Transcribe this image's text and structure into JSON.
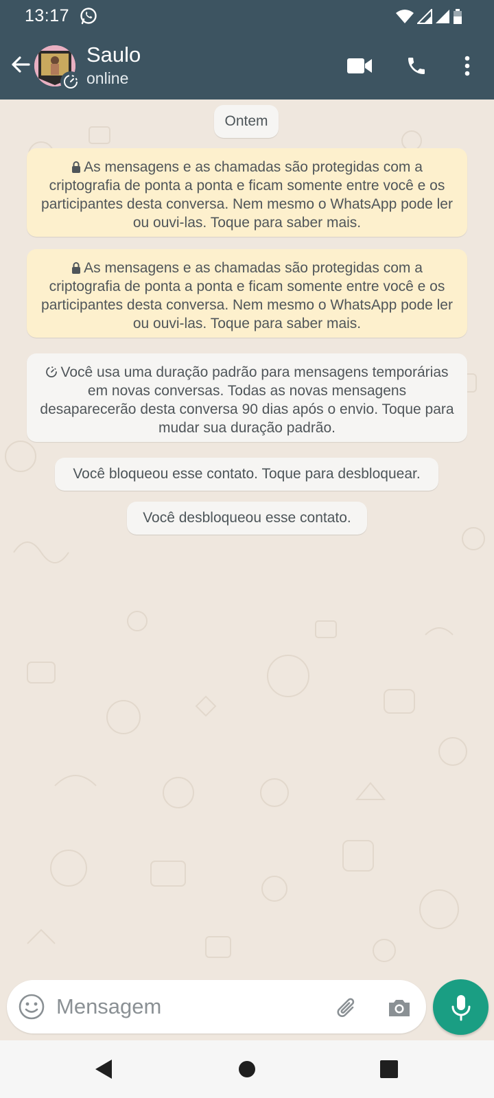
{
  "status_bar": {
    "time": "13:17",
    "icons": [
      "whatsapp-icon",
      "wifi-icon",
      "signal-icon",
      "signal-icon",
      "battery-icon"
    ]
  },
  "header": {
    "contact_name": "Saulo",
    "contact_status": "online",
    "actions": [
      "video-call-icon",
      "phone-icon",
      "more-vert-icon"
    ],
    "color": "#3d5461"
  },
  "chat": {
    "date_label": "Ontem",
    "encryption_notice_1": "As mensagens e as chamadas são protegidas com a criptografia de ponta a ponta e ficam somente entre você e os participantes desta conversa. Nem mesmo o WhatsApp pode ler ou ouvi-las. Toque para saber mais.",
    "encryption_notice_2": "As mensagens e as chamadas são protegidas com a criptografia de ponta a ponta e ficam somente entre você e os participantes desta conversa. Nem mesmo o WhatsApp pode ler ou ouvi-las. Toque para saber mais.",
    "disappearing_notice": "Você usa uma duração padrão para mensagens temporárias em novas conversas. Todas as novas mensagens desaparecerão desta conversa 90 dias após o envio. Toque para mudar sua duração padrão.",
    "blocked_notice": "Você bloqueou esse contato. Toque para desbloquear.",
    "unblocked_notice": "Você desbloqueou esse contato."
  },
  "composer": {
    "placeholder": "Mensagem",
    "accent": "#1a9e83"
  },
  "navbar": {
    "buttons": [
      "back-triangle-icon",
      "home-circle-icon",
      "recents-square-icon"
    ]
  }
}
